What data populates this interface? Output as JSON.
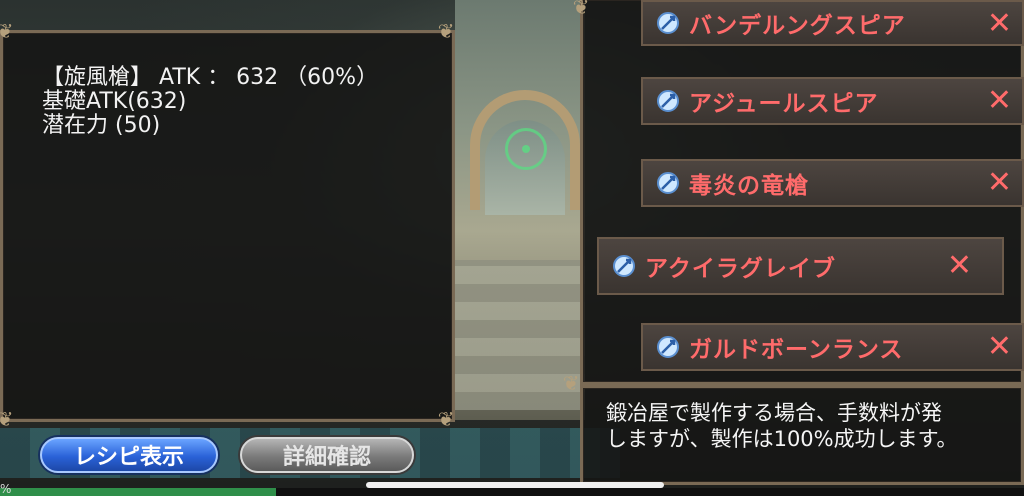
{
  "stats": {
    "line1": "【旋風槍】 ATK ： 632 （60%）",
    "line2": "基礎ATK(632)",
    "line3": "潜在力 (50)"
  },
  "items": [
    {
      "name": "バンデルングスピア",
      "icon": "spear-gem-icon",
      "remove": "✕"
    },
    {
      "name": "アジュールスピア",
      "icon": "spear-gem-icon",
      "remove": "✕"
    },
    {
      "name": "毒炎の竜槍",
      "icon": "spear-gem-icon",
      "remove": "✕"
    },
    {
      "name": "アクイラグレイブ",
      "icon": "spear-gem-icon",
      "remove": "✕"
    },
    {
      "name": "ガルドボーンランス",
      "icon": "spear-gem-icon",
      "remove": "✕"
    }
  ],
  "info": {
    "line1": "鍛冶屋で製作する場合、手数料が発",
    "line2": "しますが、製作は100%成功します。"
  },
  "buttons": {
    "recipe": "レシピ表示",
    "detail": "詳細確認"
  },
  "status": {
    "percent_text": "%",
    "progress_fraction": 0.27
  },
  "colors": {
    "item_name": "#ff6b6b",
    "recipe_button": "#2a62d8",
    "detail_button": "#7a7a7a"
  }
}
